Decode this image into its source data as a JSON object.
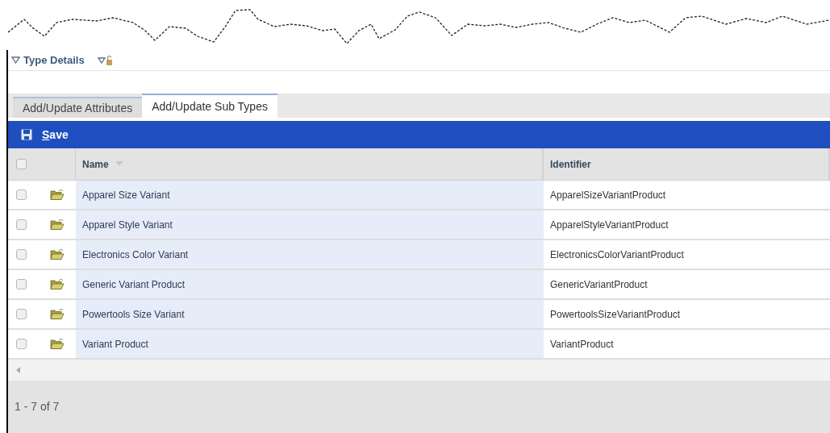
{
  "section": {
    "title": "Type Details",
    "expanded": true
  },
  "tabs": [
    {
      "label": "Add/Update Attributes",
      "selected": false
    },
    {
      "label": "Add/Update Sub Types",
      "selected": true
    }
  ],
  "toolbar": {
    "save_label": "Save"
  },
  "table": {
    "select_all": {
      "checked": false
    },
    "columns": [
      {
        "label": "Name",
        "sorted": true
      },
      {
        "label": "Identifier",
        "sorted": false
      }
    ],
    "rows": [
      {
        "name": "Apparel Size Variant",
        "identifier": "ApparelSizeVariantProduct",
        "checked": false
      },
      {
        "name": "Apparel Style Variant",
        "identifier": "ApparelStyleVariantProduct",
        "checked": false
      },
      {
        "name": "Electronics Color Variant",
        "identifier": "ElectronicsColorVariantProduct",
        "checked": false
      },
      {
        "name": "Generic Variant Product",
        "identifier": "GenericVariantProduct",
        "checked": false
      },
      {
        "name": "Powertools Size Variant",
        "identifier": "PowertoolsSizeVariantProduct",
        "checked": false
      },
      {
        "name": "Variant Product",
        "identifier": "VariantProduct",
        "checked": false
      }
    ]
  },
  "pager": {
    "text": "1 - 7 of 7"
  }
}
